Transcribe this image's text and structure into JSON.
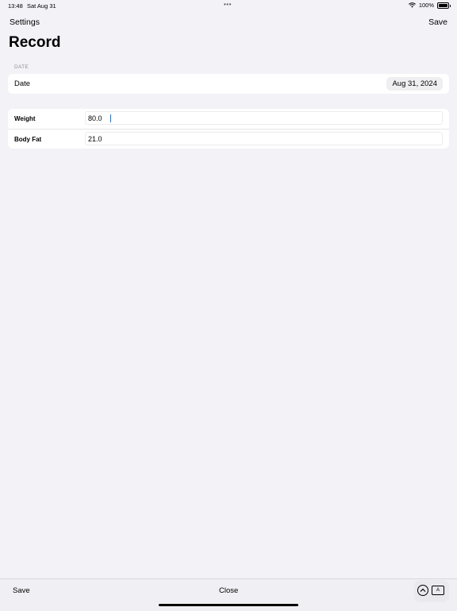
{
  "status": {
    "time": "13:48",
    "date": "Sat Aug 31",
    "battery": "100%"
  },
  "nav": {
    "back_label": "Settings",
    "save_label": "Save"
  },
  "title": "Record",
  "date_section": {
    "header": "DATE",
    "label": "Date",
    "value": "Aug 31, 2024"
  },
  "fields": [
    {
      "label": "Weight",
      "value": "80.0"
    },
    {
      "label": "Body Fat",
      "value": "21.0"
    }
  ],
  "toolbar": {
    "save_label": "Save",
    "close_label": "Close",
    "keyboard_glyph": "A"
  },
  "colors": {
    "background": "#f2f2f7",
    "accent": "#007aff"
  }
}
